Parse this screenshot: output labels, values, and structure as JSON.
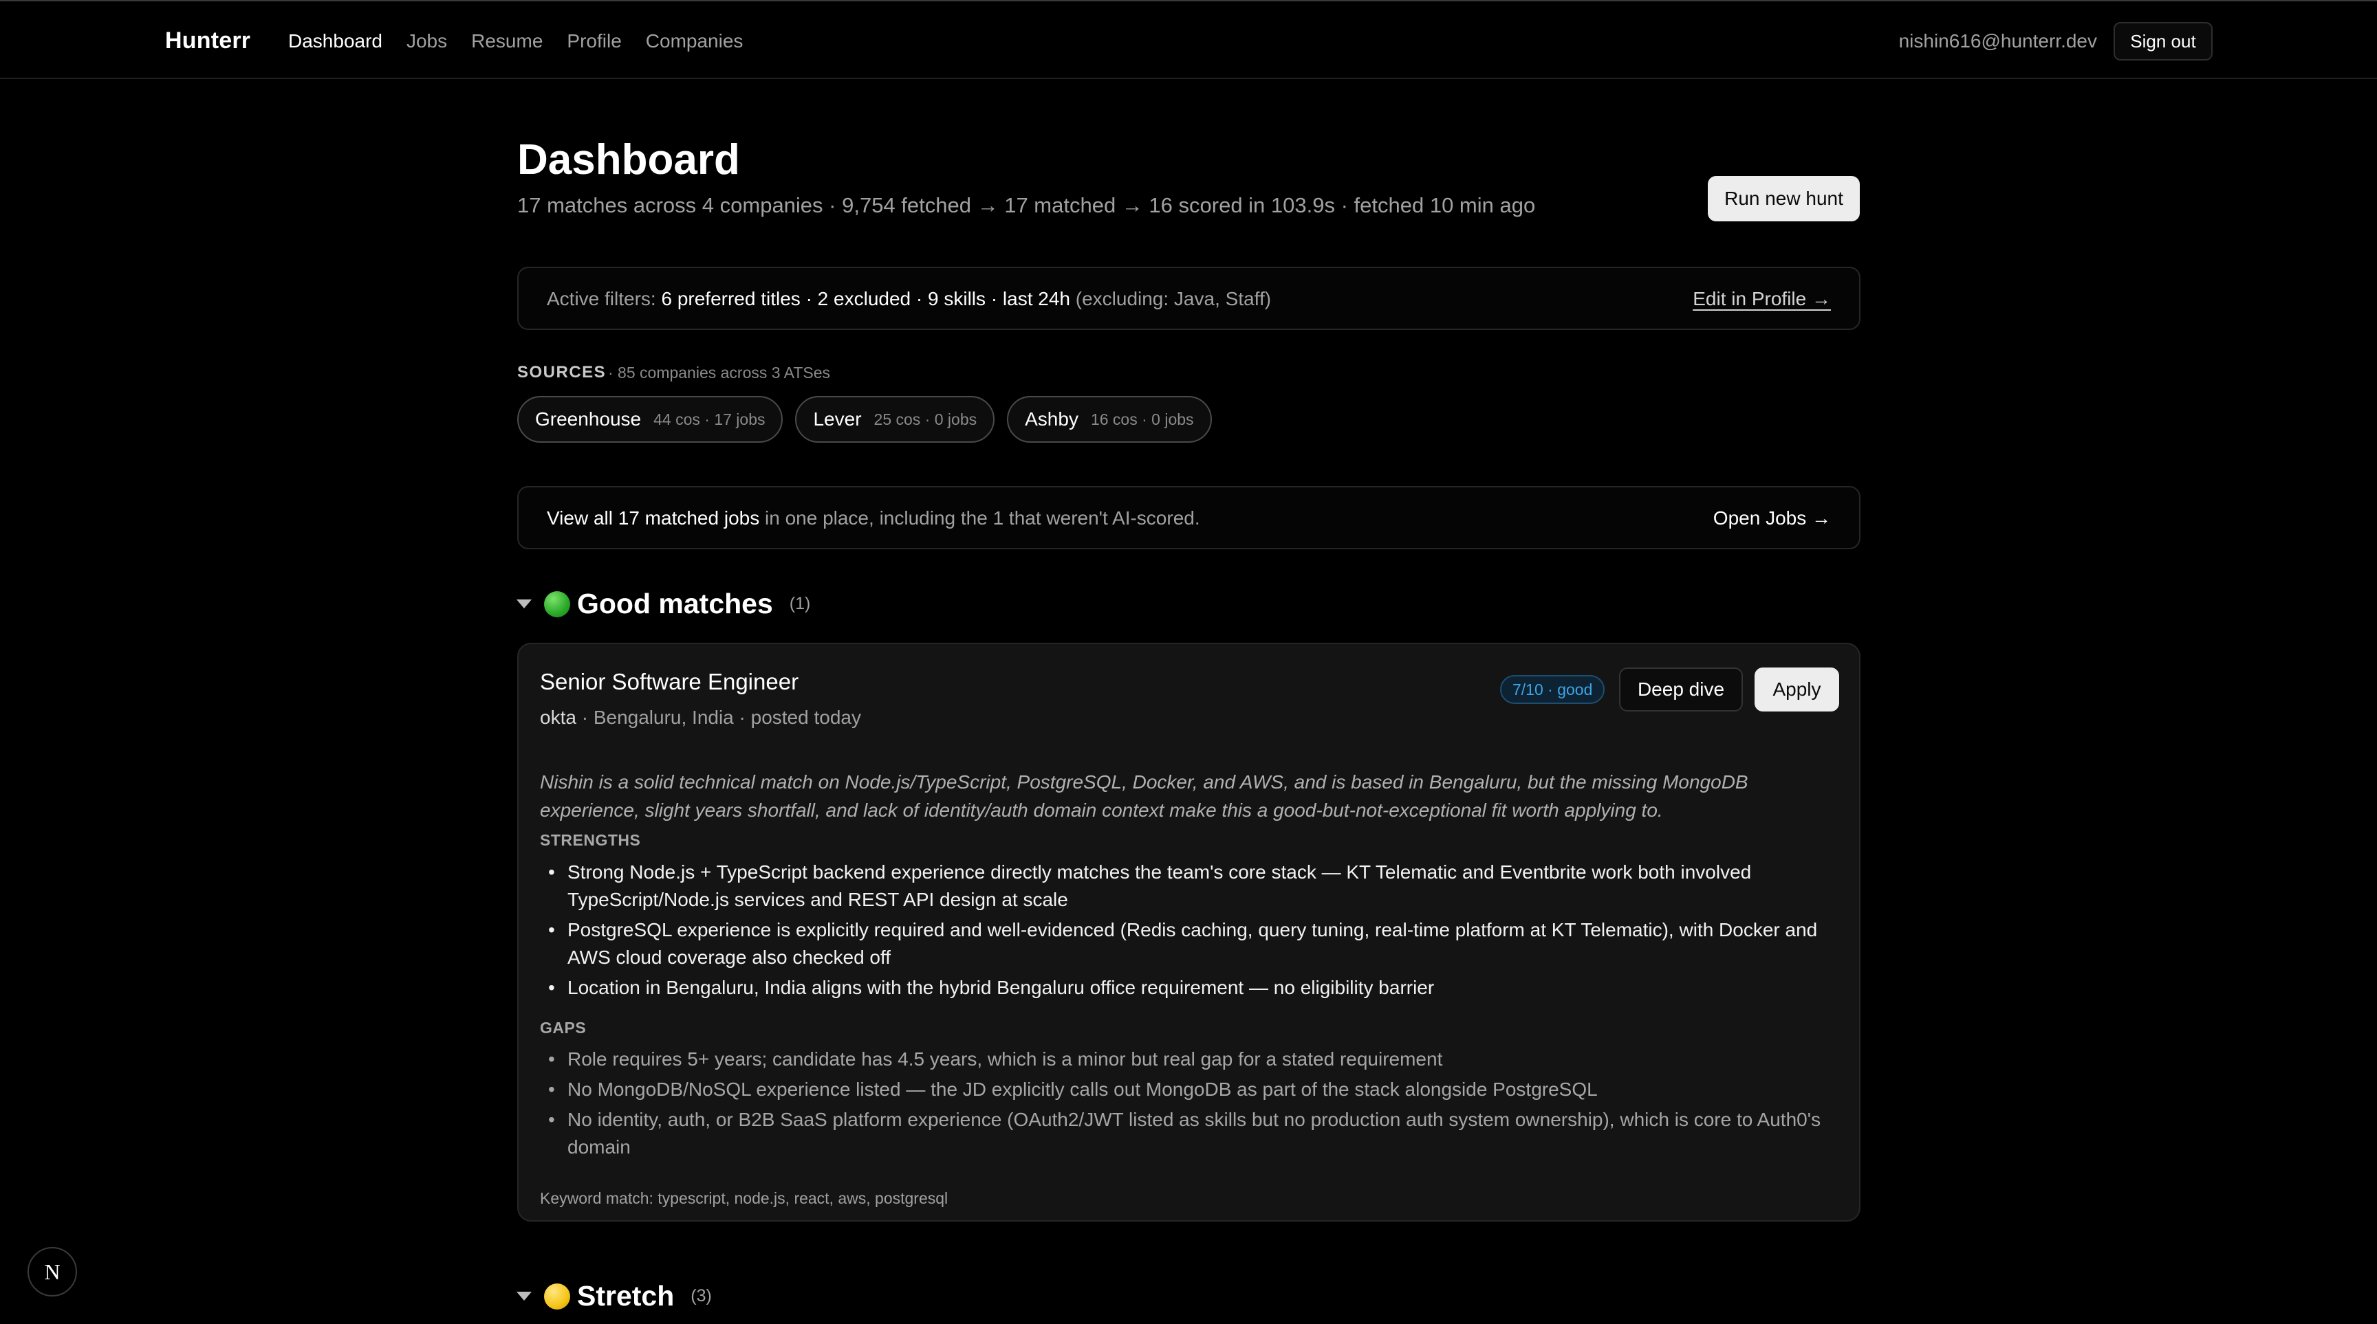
{
  "nav": {
    "brand": "Hunterr",
    "items": [
      {
        "label": "Dashboard",
        "active": true
      },
      {
        "label": "Jobs",
        "active": false
      },
      {
        "label": "Resume",
        "active": false
      },
      {
        "label": "Profile",
        "active": false
      },
      {
        "label": "Companies",
        "active": false
      }
    ],
    "user_email": "nishin616@hunterr.dev",
    "signout_label": "Sign out"
  },
  "header": {
    "title": "Dashboard",
    "subtitle": "17 matches across 4 companies · 9,754 fetched → 17 matched → 16 scored in 103.9s · fetched 10 min ago",
    "run_label": "Run new hunt"
  },
  "filters": {
    "prefix": "Active filters: ",
    "summary": "6 preferred titles · 2 excluded · 9 skills · last 24h",
    "excluding": " (excluding: Java, Staff)",
    "edit_label": "Edit in Profile →"
  },
  "sources": {
    "label": "SOURCES",
    "sub": "· 85 companies across 3 ATSes",
    "items": [
      {
        "name": "Greenhouse",
        "meta": "44 cos · 17 jobs"
      },
      {
        "name": "Lever",
        "meta": "25 cos · 0 jobs"
      },
      {
        "name": "Ashby",
        "meta": "16 cos · 0 jobs"
      }
    ]
  },
  "viewall": {
    "bold": "View all 17 matched jobs",
    "rest": " in one place, including the 1 that weren't AI-scored.",
    "open_label": "Open Jobs →"
  },
  "sections": {
    "good": {
      "label": "Good matches",
      "count": "(1)"
    },
    "stretch": {
      "label": "Stretch",
      "count": "(3)"
    }
  },
  "job": {
    "title": "Senior Software Engineer",
    "company": "okta",
    "meta": " · Bengaluru, India · posted today",
    "score": "7/10 · good",
    "deep_dive_label": "Deep dive",
    "apply_label": "Apply",
    "summary": "Nishin is a solid technical match on Node.js/TypeScript, PostgreSQL, Docker, and AWS, and is based in Bengaluru, but the missing MongoDB experience, slight years shortfall, and lack of identity/auth domain context make this a good-but-not-exceptional fit worth applying to.",
    "strengths_label": "STRENGTHS",
    "strengths": [
      "Strong Node.js + TypeScript backend experience directly matches the team's core stack — KT Telematic and Eventbrite work both involved TypeScript/Node.js services and REST API design at scale",
      "PostgreSQL experience is explicitly required and well-evidenced (Redis caching, query tuning, real-time platform at KT Telematic), with Docker and AWS cloud coverage also checked off",
      "Location in Bengaluru, India aligns with the hybrid Bengaluru office requirement — no eligibility barrier"
    ],
    "gaps_label": "GAPS",
    "gaps": [
      "Role requires 5+ years; candidate has 4.5 years, which is a minor but real gap for a stated requirement",
      "No MongoDB/NoSQL experience listed — the JD explicitly calls out MongoDB as part of the stack alongside PostgreSQL",
      "No identity, auth, or B2B SaaS platform experience (OAuth2/JWT listed as skills but no production auth system ownership), which is core to Auth0's domain"
    ],
    "keywords": "Keyword match: typescript, node.js, react, aws, postgresql"
  },
  "badge": {
    "letter": "N"
  }
}
